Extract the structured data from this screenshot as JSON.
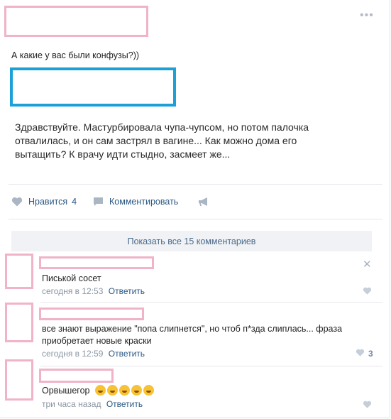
{
  "post": {
    "text": "А какие у вас были конфузы?))",
    "repost_text": "Здравствуйте. Мастурбировала чупа-чупсом, но потом палочка отвалилась, и он сам застрял в вагине... Как можно дома его вытащить? К врачу идти стыдно, засмеет же...",
    "more_icon": "more-dots-icon"
  },
  "actions": {
    "like_label": "Нравится",
    "like_count": "4",
    "comment_label": "Комментировать",
    "share_icon": "megaphone-icon"
  },
  "comments": {
    "show_all": "Показать все 15 комментариев",
    "items": [
      {
        "text": "Писькой сосет",
        "time": "сегодня в 12:53",
        "reply": "Ответить",
        "likes": ""
      },
      {
        "text": "все знают выражение \"попа слипнется\", но чтоб п*зда слиплась... фраза приобретает новые краски",
        "time": "сегодня в 12:59",
        "reply": "Ответить",
        "likes": "3"
      },
      {
        "text": "Орвышегор",
        "time": "три часа назад",
        "reply": "Ответить",
        "likes": "",
        "emoji_count": 5
      }
    ]
  },
  "colors": {
    "redaction_pink": "#f0b3c8",
    "redaction_blue": "#1ba1d8",
    "link": "#2a5885"
  }
}
